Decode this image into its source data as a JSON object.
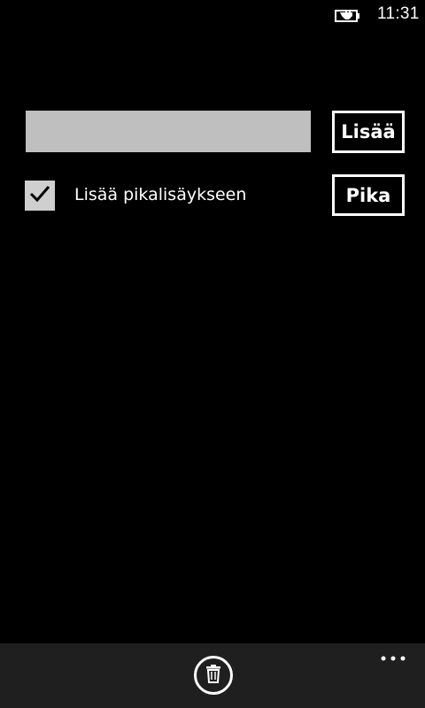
{
  "status_bar": {
    "time": "11:31",
    "battery_icon": "battery-charging-icon"
  },
  "form": {
    "input_value": "",
    "input_placeholder": "",
    "add_button_label": "Lisää",
    "quick_checkbox_checked": true,
    "quick_checkbox_label": "Lisää pikalisäykseen",
    "quick_button_label": "Pika"
  },
  "app_bar": {
    "delete_icon": "trash-icon",
    "more_icon": "ellipsis-icon"
  }
}
